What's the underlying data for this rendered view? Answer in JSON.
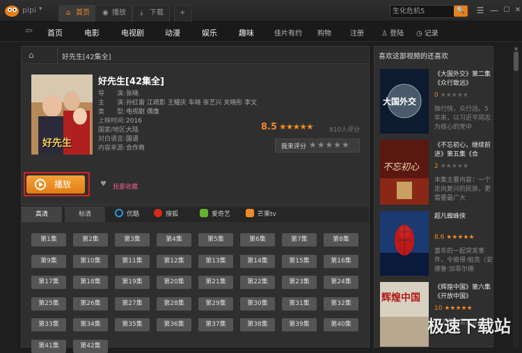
{
  "app": {
    "logo_text": "pipi",
    "logo_dropdown": "▾"
  },
  "tabs": [
    {
      "label": "首页",
      "icon": "home-icon"
    },
    {
      "label": "播放",
      "icon": "play-circle-icon"
    },
    {
      "label": "下载",
      "icon": "download-icon"
    },
    {
      "label": "+"
    }
  ],
  "search": {
    "value": "生化危机5",
    "button": "🔍"
  },
  "window_buttons": {
    "menu": "☰",
    "minimize": "—",
    "maximize": "☐",
    "close": "✕"
  },
  "nav": {
    "back": "⇦",
    "items": [
      "首页",
      "电影",
      "电视剧",
      "动漫",
      "娱乐",
      "趣味"
    ],
    "right_items": [
      "佳片有约",
      "购物",
      "注册",
      "登陆",
      "记录"
    ]
  },
  "breadcrumb": {
    "title": "好先生[42集全]"
  },
  "detail": {
    "title": "好先生[42集全]",
    "poster_text": "好先生",
    "meta": [
      {
        "k": "导　　演:",
        "v": "张晓"
      },
      {
        "k": "主　　演:",
        "v": "孙红雷  江疏影  王耀庆  车晓  张艺兴  关晓彤  李文"
      },
      {
        "k": "类　　型:",
        "v": "电视剧  偶像"
      },
      {
        "k": "上映时间:",
        "v": "2016"
      },
      {
        "k": "国家/地区:",
        "v": "大陆"
      },
      {
        "k": "对白语言:",
        "v": "国语"
      },
      {
        "k": "内容来源:",
        "v": "合作商"
      }
    ],
    "score": "8.5",
    "score_stars": "★★★★★",
    "score_count": "810人评分",
    "rate_label": "我来评分",
    "rate_stars": "★★★★★",
    "rating_fraction": 0.85
  },
  "actions": {
    "play": "播放",
    "favorite": "我要收藏"
  },
  "sources": {
    "quality": [
      "高清",
      "标清"
    ],
    "providers": [
      {
        "name": "优酷",
        "color": "#2a9ae0"
      },
      {
        "name": "搜狐",
        "color": "#d8281c"
      },
      {
        "name": "爱奇艺",
        "color": "#62b22f"
      },
      {
        "name": "芒果tv",
        "color": "#f08a24"
      }
    ]
  },
  "episodes": [
    "第1集",
    "第2集",
    "第3集",
    "第4集",
    "第5集",
    "第6集",
    "第7集",
    "第8集",
    "第9集",
    "第10集",
    "第11集",
    "第12集",
    "第13集",
    "第14集",
    "第15集",
    "第16集",
    "第17集",
    "第18集",
    "第19集",
    "第20集",
    "第21集",
    "第22集",
    "第23集",
    "第24集",
    "第25集",
    "第26集",
    "第27集",
    "第28集",
    "第29集",
    "第30集",
    "第31集",
    "第32集",
    "第33集",
    "第34集",
    "第35集",
    "第36集",
    "第37集",
    "第38集",
    "第39集",
    "第40集",
    "第41集",
    "第42集"
  ],
  "sidebar": {
    "title": "喜欢这部视频的还喜欢",
    "items": [
      {
        "title": "《大国外交》第二集《众行致远》",
        "score": "0",
        "stars": "★★★★★",
        "desc": "独行快，众行远。5年来，以习近平同志为核心的党中",
        "thumb_text": "大国外交",
        "thumb_bg": "#0d1a30"
      },
      {
        "title": "《不忘初心，继续前进》第五集《合",
        "score": "2",
        "stars": "★★★★★",
        "desc": "本集主要内容：一个走向复兴的民族，更需要最广大",
        "thumb_text": "不忘初心",
        "thumb_bg": "#5a1810"
      },
      {
        "title": "超凡蜘蛛侠",
        "score": "8.6",
        "stars": "★★★★★",
        "desc": "童年的一起突发事件，令彼得·帕克（安德鲁·加菲尔德",
        "thumb_text": "",
        "thumb_bg": "#1b3a70"
      },
      {
        "title": "《辉煌中国》第六集《开放中国》",
        "score": "10",
        "stars": "★★★★★",
        "desc": "由之路。面对世界",
        "thumb_text": "辉煌中国",
        "thumb_bg": "#d8d0c0"
      }
    ]
  },
  "watermark": "极速下载站"
}
